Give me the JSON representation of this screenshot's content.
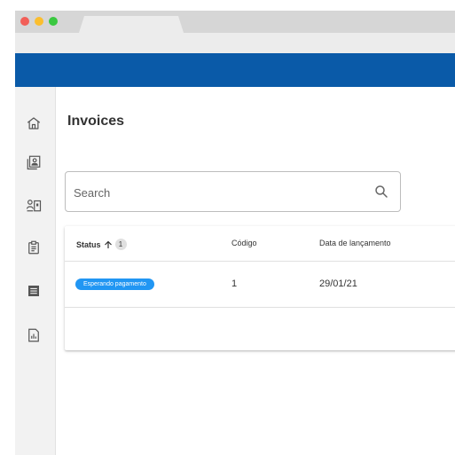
{
  "browser": {
    "colors": {
      "close": "#f25f58",
      "minimize": "#fbbe2e",
      "maximize": "#3ac840"
    }
  },
  "appbar": {
    "color": "#0a5aa8"
  },
  "sidebar": {
    "items": [
      {
        "icon": "home-icon"
      },
      {
        "icon": "contact-card-icon"
      },
      {
        "icon": "user-badge-icon"
      },
      {
        "icon": "clipboard-icon"
      },
      {
        "icon": "document-list-icon"
      },
      {
        "icon": "report-chart-icon"
      }
    ]
  },
  "main": {
    "title": "Invoices",
    "search": {
      "placeholder": "Search",
      "value": "",
      "icon": "search-icon"
    },
    "table": {
      "columns": [
        {
          "label": "Status",
          "sorted": "ascending",
          "sort_badge": "1"
        },
        {
          "label": "Código"
        },
        {
          "label": "Data de lançamento"
        }
      ],
      "rows": [
        {
          "status": "Esperando pagamento",
          "codigo": "1",
          "data": "29/01/21"
        }
      ],
      "status_color": "#2196f3"
    }
  }
}
